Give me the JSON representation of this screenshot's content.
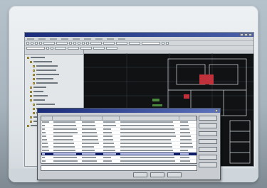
{
  "app": {
    "window_title": "",
    "menus": [
      "",
      "",
      "",
      "",
      "",
      "",
      "",
      "",
      ""
    ],
    "layer_combo": ""
  },
  "file_tree": {
    "items": [
      "",
      "",
      "",
      "",
      "",
      "",
      "",
      "",
      "",
      "",
      "",
      "",
      "",
      "",
      "",
      "",
      ""
    ]
  },
  "dialog": {
    "title": "",
    "columns": [
      "",
      "",
      "",
      "",
      "",
      ""
    ],
    "rows": [
      [
        "",
        "",
        "",
        "",
        "",
        ""
      ],
      [
        "",
        "",
        "",
        "",
        "",
        ""
      ],
      [
        "",
        "",
        "",
        "",
        "",
        ""
      ],
      [
        "",
        "",
        "",
        "",
        "",
        ""
      ],
      [
        "",
        "",
        "",
        "",
        "",
        ""
      ],
      [
        "",
        "",
        "",
        "",
        "",
        ""
      ],
      [
        "",
        "",
        "",
        "",
        "",
        ""
      ],
      [
        "",
        "",
        "",
        "",
        "",
        ""
      ],
      [
        "",
        "",
        "",
        "",
        "",
        ""
      ],
      [
        "",
        "",
        "",
        "",
        "",
        ""
      ],
      [
        "",
        "",
        "",
        "",
        "",
        ""
      ],
      [
        "",
        "",
        "",
        "",
        "",
        ""
      ]
    ],
    "selected_row": 9,
    "side_buttons": [
      "",
      "",
      "",
      "",
      "",
      "",
      ""
    ],
    "path_value": "",
    "bottom_buttons": [
      "",
      "",
      ""
    ]
  },
  "colors": {
    "title_bar": "#1a2c7a",
    "drawing_background": "#101214",
    "highlight_red": "#c0313c",
    "selection": "#0d1a66"
  }
}
